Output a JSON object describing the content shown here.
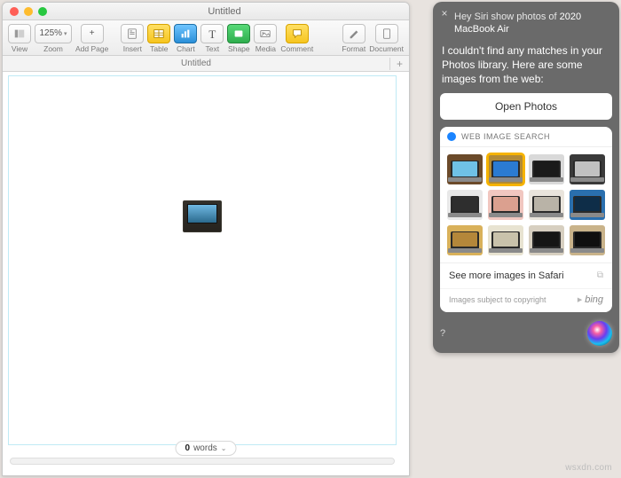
{
  "pages_window": {
    "title": "Untitled",
    "toolbar": {
      "view_label": "View",
      "zoom_label": "Zoom",
      "zoom_value": "125%",
      "addpage_label": "Add Page",
      "insert_label": "Insert",
      "table_label": "Table",
      "chart_label": "Chart",
      "text_label": "Text",
      "shape_label": "Shape",
      "media_label": "Media",
      "comment_label": "Comment",
      "format_label": "Format",
      "document_label": "Document"
    },
    "tab_label": "Untitled",
    "wordcount_value": "0",
    "wordcount_label": "words"
  },
  "siri": {
    "query_prefix": "Hey Siri show photos of ",
    "query_highlight": "2020 MacBook Air",
    "message": "I couldn't find any matches in your Photos library. Here are some images from the web:",
    "open_photos_label": "Open Photos",
    "card_title": "WEB IMAGE SEARCH",
    "more_label": "See more images in Safari",
    "copyright_label": "Images subject to copyright",
    "provider_label": "bing",
    "thumbs": [
      {
        "bg": "#6b4a2a",
        "screen": "#6fc1e6",
        "selected": false
      },
      {
        "bg": "#b28a36",
        "screen": "#2b7bd1",
        "selected": true
      },
      {
        "bg": "#d9d9d9",
        "screen": "#1a1a1a",
        "selected": false
      },
      {
        "bg": "#3a3a3a",
        "screen": "#c1c1c1",
        "selected": false
      },
      {
        "bg": "#e8e8e8",
        "screen": "#2e2e2e",
        "selected": false
      },
      {
        "bg": "#f1c7c0",
        "screen": "#dba08f",
        "selected": false
      },
      {
        "bg": "#e9e4dc",
        "screen": "#b9b3a7",
        "selected": false
      },
      {
        "bg": "#2a6fae",
        "screen": "#0e2d48",
        "selected": false
      },
      {
        "bg": "#d9b15a",
        "screen": "#b4873a",
        "selected": false
      },
      {
        "bg": "#e8e3d1",
        "screen": "#c9c2ab",
        "selected": false
      },
      {
        "bg": "#d7cfc0",
        "screen": "#151515",
        "selected": false
      },
      {
        "bg": "#c9b38a",
        "screen": "#0f0f0f",
        "selected": false
      }
    ]
  },
  "watermark": "wsxdn.com"
}
